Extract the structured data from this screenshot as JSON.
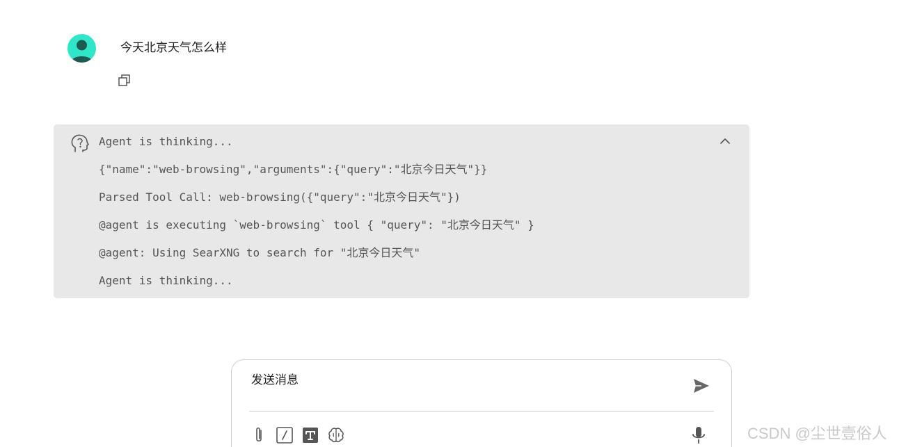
{
  "user_message": {
    "text": "今天北京天气怎么样",
    "avatar_icon": "user-avatar-icon",
    "avatar_color": "#2ee6c8",
    "copy_icon": "copy-icon"
  },
  "thinking": {
    "icon": "brain-head-icon",
    "collapse_icon": "chevron-up-icon",
    "panel_color": "#e8e8e8",
    "lines": [
      "Agent is thinking...",
      "{\"name\":\"web-browsing\",\"arguments\":{\"query\":\"北京今日天气\"}}",
      "Parsed Tool Call: web-browsing({\"query\":\"北京今日天气\"})",
      "@agent is executing `web-browsing` tool { \"query\": \"北京今日天气\" }",
      "@agent: Using SearXNG to search for \"北京今日天气\"",
      "Agent is thinking..."
    ]
  },
  "composer": {
    "placeholder": "发送消息",
    "send_icon": "send-icon",
    "tools": [
      "paperclip-icon",
      "slash-command-icon",
      "text-format-icon",
      "brain-icon"
    ],
    "mic_icon": "microphone-icon"
  },
  "watermark": "CSDN @尘世壹俗人"
}
